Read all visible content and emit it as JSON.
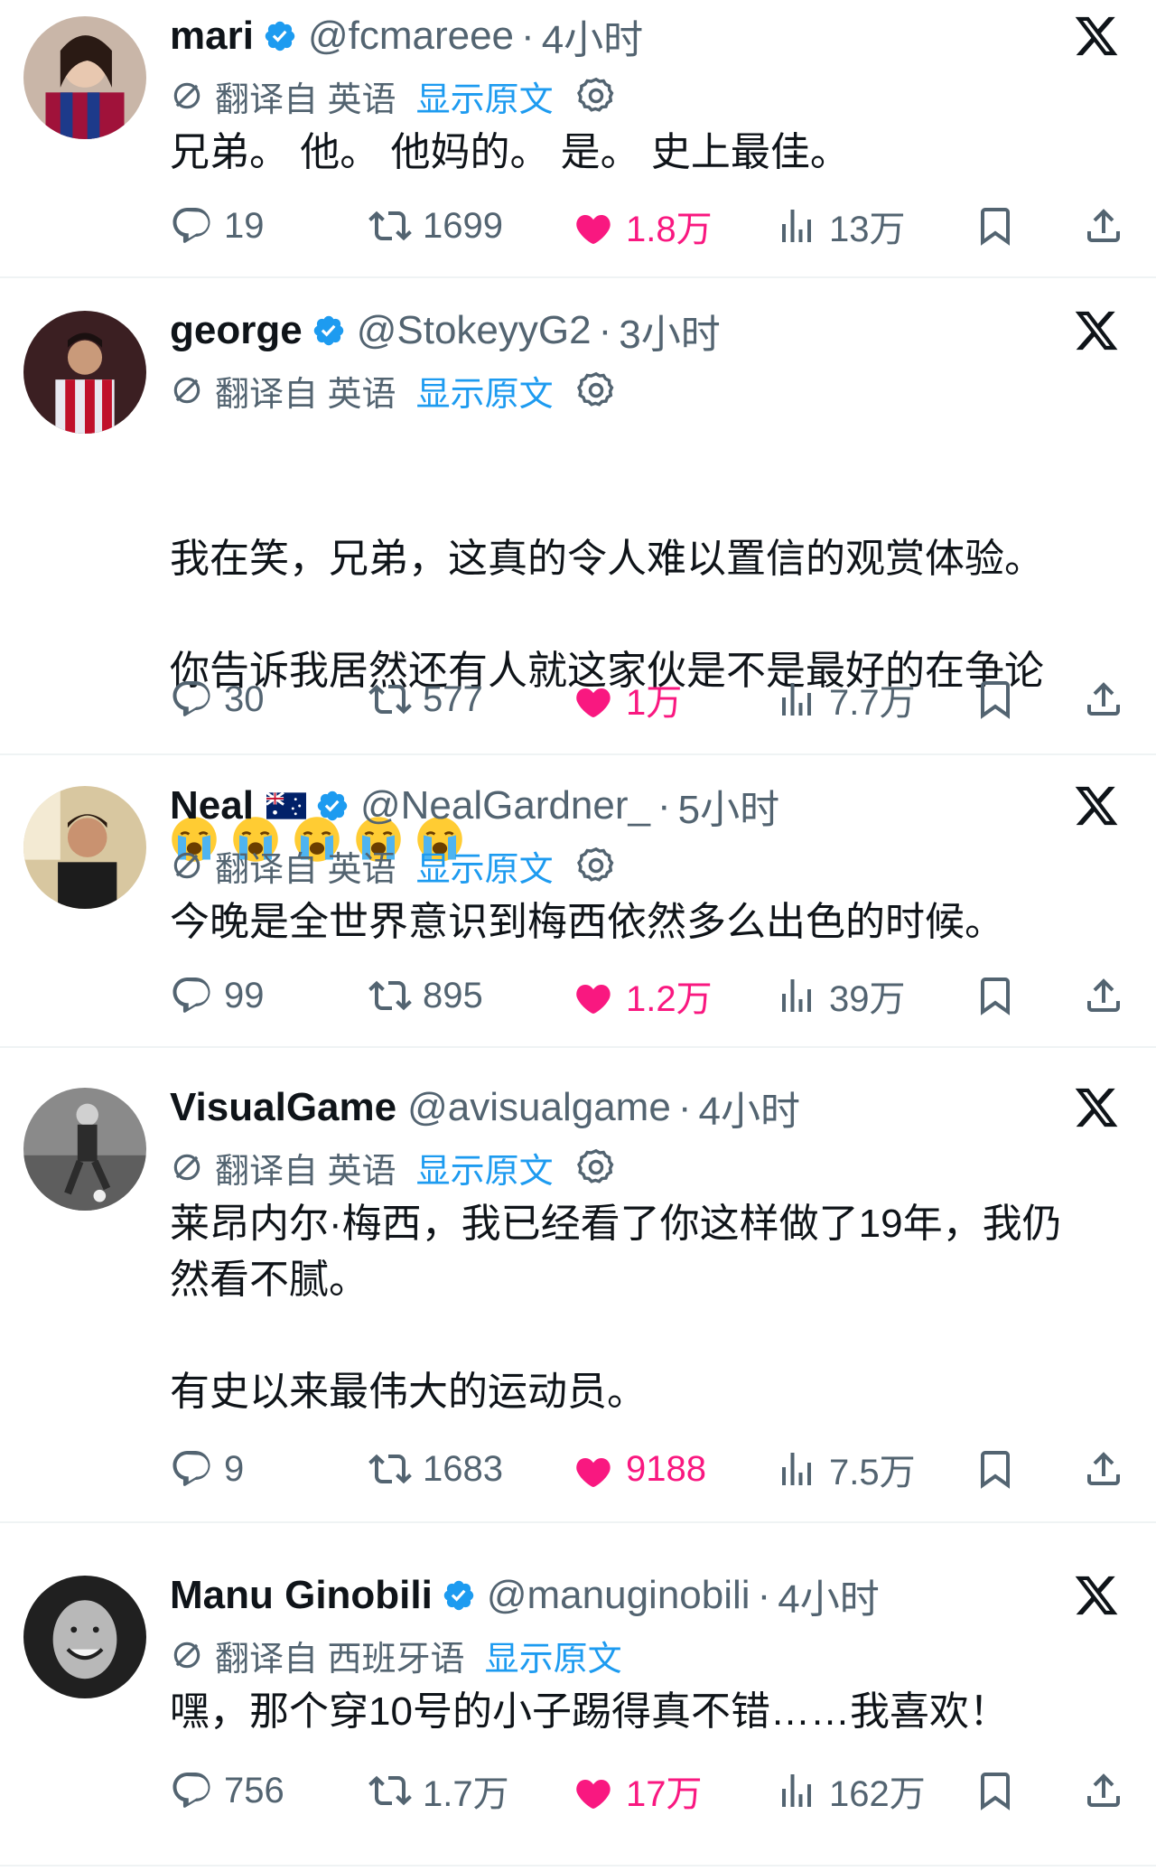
{
  "tweets": [
    {
      "name": "mari",
      "handle": "@fcmareee",
      "time": "4小时",
      "translate_label": "翻译自 英语",
      "show_original": "显示原文",
      "text": "兄弟。 他。 他妈的。 是。 史上最佳。",
      "replies": "19",
      "retweets": "1699",
      "likes": "1.8万",
      "views": "13万"
    },
    {
      "name": "george",
      "handle": "@StokeyyG2",
      "time": "3小时",
      "translate_label": "翻译自 英语",
      "show_original": "显示原文",
      "text": "我在笑，兄弟，这真的令人难以置信的观赏体验。\n\n你告诉我居然还有人就这家伙是不是最好的在争论",
      "replies": "30",
      "retweets": "577",
      "likes": "1万",
      "views": "7.7万"
    },
    {
      "name": "Neal",
      "handle": "@NealGardner_",
      "time": "5小时",
      "translate_label": "翻译自 英语",
      "show_original": "显示原文",
      "text": "今晚是全世界意识到梅西依然多么出色的时候。",
      "replies": "99",
      "retweets": "895",
      "likes": "1.2万",
      "views": "39万"
    },
    {
      "name": "VisualGame",
      "handle": "@avisualgame",
      "time": "4小时",
      "translate_label": "翻译自 英语",
      "show_original": "显示原文",
      "text": "莱昂内尔·梅西，我已经看了你这样做了19年，我仍\n然看不腻。\n\n有史以来最伟大的运动员。",
      "replies": "9",
      "retweets": "1683",
      "likes": "9188",
      "views": "7.5万"
    },
    {
      "name": "Manu Ginobili",
      "handle": "@manuginobili",
      "time": "4小时",
      "translate_label": "翻译自 西班牙语",
      "show_original": "显示原文",
      "text": "嘿，那个穿10号的小子踢得真不错……我喜欢！",
      "replies": "756",
      "retweets": "1.7万",
      "likes": "17万",
      "views": "162万"
    }
  ],
  "colors": {
    "text": "#0f1419",
    "muted": "#536471",
    "link": "#1d9bf0",
    "like": "#f91880",
    "verified": "#1d9bf0",
    "divider": "#eff3f4"
  },
  "icons": [
    "verified-badge-icon",
    "x-logo-icon",
    "translate-icon",
    "gear-icon",
    "reply-icon",
    "retweet-icon",
    "heart-icon",
    "views-icon",
    "bookmark-icon",
    "share-icon",
    "crying-emoji-icon",
    "australia-flag-icon"
  ]
}
